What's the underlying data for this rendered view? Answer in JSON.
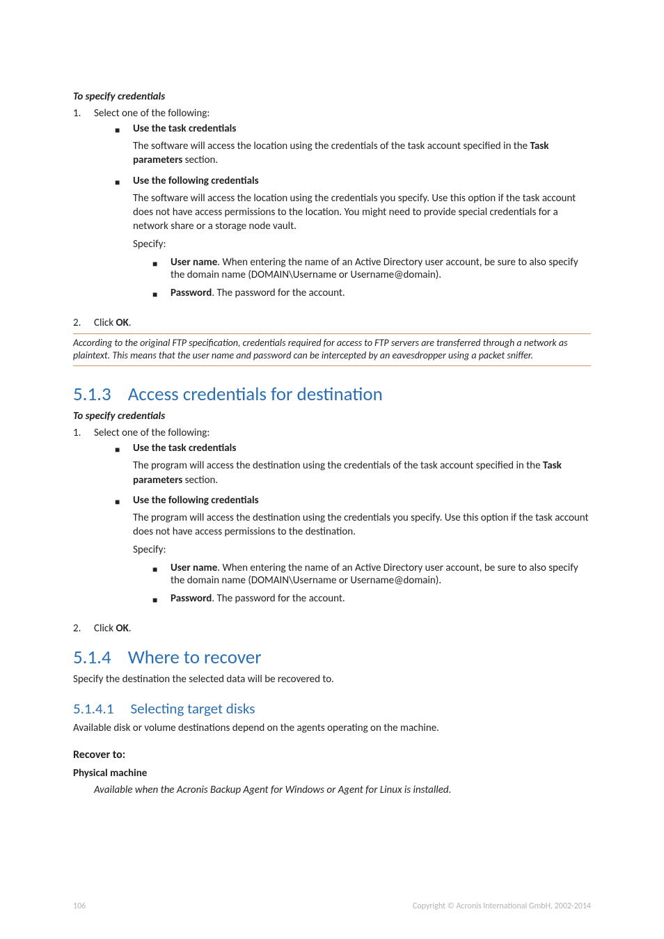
{
  "section1": {
    "heading": "To specify credentials",
    "step1": "Select one of the following:",
    "item1": {
      "title": "Use the task credentials",
      "body_pre": "The software will access the location using the credentials of the task account specified in the ",
      "body_bold": "Task parameters",
      "body_post": " section."
    },
    "item2": {
      "title": "Use the following credentials",
      "body": "The software will access the location using the credentials you specify. Use this option if the task account does not have access permissions to the location. You might need to provide special credentials for a network share or a storage node vault.",
      "specify": "Specify:",
      "sub1_bold": "User name",
      "sub1_rest": ". When entering the name of an Active Directory user account, be sure to also specify the domain name (DOMAIN\\Username or Username@domain).",
      "sub2_bold": "Password",
      "sub2_rest": ". The password for the account."
    },
    "step2_pre": "Click ",
    "step2_bold": "OK",
    "step2_post": "."
  },
  "note": "According to the original FTP specification, credentials required for access to FTP servers are transferred through a network as plaintext. This means that the user name and password can be intercepted by an eavesdropper using a packet sniffer.",
  "section2": {
    "num": "5.1.3",
    "title": "Access credentials for destination",
    "heading": "To specify credentials",
    "step1": "Select one of the following:",
    "item1": {
      "title": "Use the task credentials",
      "body_pre": "The program will access the destination using the credentials of the task account specified in the ",
      "body_bold": "Task parameters",
      "body_post": " section."
    },
    "item2": {
      "title": "Use the following credentials",
      "body": "The program will access the destination using the credentials you specify. Use this option if the task account does not have access permissions to the destination.",
      "specify": "Specify:",
      "sub1_bold": "User name",
      "sub1_rest": ". When entering the name of an Active Directory user account, be sure to also specify the domain name (DOMAIN\\Username or Username@domain).",
      "sub2_bold": "Password",
      "sub2_rest": ". The password for the account."
    },
    "step2_pre": "Click ",
    "step2_bold": "OK",
    "step2_post": "."
  },
  "section3": {
    "num": "5.1.4",
    "title": "Where to recover",
    "para": "Specify the destination the selected data will be recovered to."
  },
  "section4": {
    "num": "5.1.4.1",
    "title": "Selecting target disks",
    "para": "Available disk or volume destinations depend on the agents operating on the machine.",
    "h1": "Recover to:",
    "h2": "Physical machine",
    "indent": "Available when the Acronis Backup Agent for Windows or Agent for Linux is installed."
  },
  "footer": {
    "page": "106",
    "copyright": "Copyright © Acronis International GmbH, 2002-2014"
  }
}
